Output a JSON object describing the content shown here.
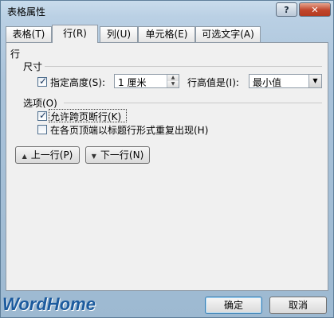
{
  "window": {
    "title": "表格属性",
    "help_label": "?",
    "close_label": "✕"
  },
  "tabs": [
    {
      "label": "表格(T)",
      "active": false
    },
    {
      "label": "行(R)",
      "active": true
    },
    {
      "label": "列(U)",
      "active": false
    },
    {
      "label": "单元格(E)",
      "active": false
    },
    {
      "label": "可选文字(A)",
      "active": false
    }
  ],
  "row_panel": {
    "heading": "行",
    "size_label": "尺寸",
    "specify_height": {
      "label": "指定高度(S):",
      "checked": true
    },
    "height_value": "1 厘米",
    "row_height_is_label": "行高值是(I):",
    "row_height_is_value": "最小值",
    "options_label": "选项(O)",
    "allow_break": {
      "label": "允许跨页断行(K)",
      "checked": true
    },
    "repeat_header": {
      "label": "在各页顶端以标题行形式重复出现(H)",
      "checked": false
    },
    "prev_row_label": "上一行(P)",
    "next_row_label": "下一行(N)"
  },
  "footer": {
    "logo_text": "WordHome",
    "ok_label": "确定",
    "cancel_label": "取消"
  }
}
